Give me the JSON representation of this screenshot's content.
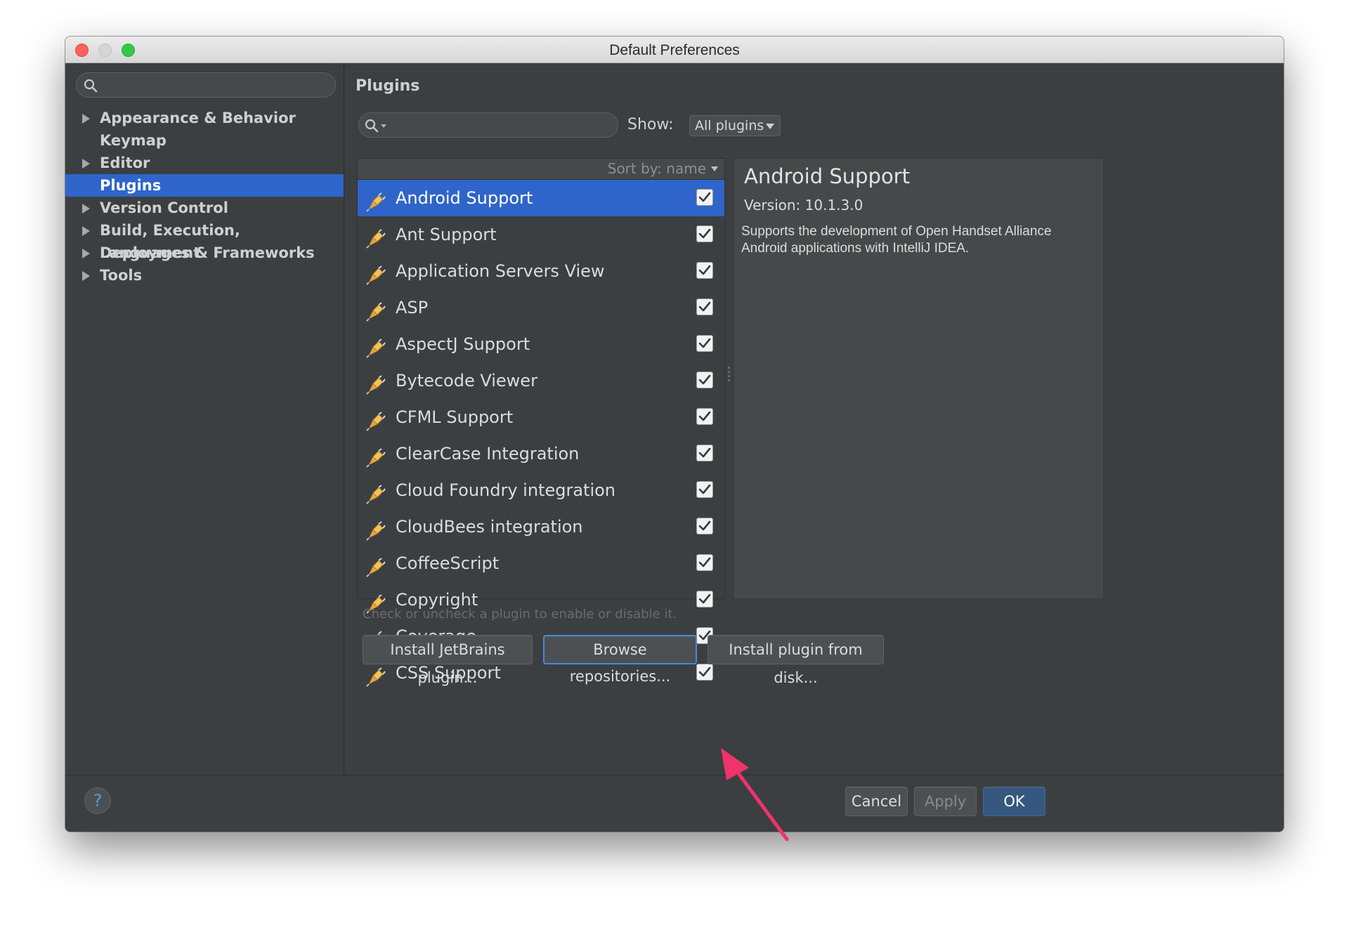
{
  "window": {
    "title": "Default Preferences"
  },
  "sidebar": {
    "search": {
      "placeholder": "",
      "icon": "search-icon"
    },
    "items": [
      {
        "label": "Appearance & Behavior",
        "expandable": true
      },
      {
        "label": "Keymap",
        "expandable": false
      },
      {
        "label": "Editor",
        "expandable": true
      },
      {
        "label": "Plugins",
        "expandable": false,
        "selected": true
      },
      {
        "label": "Version Control",
        "expandable": true
      },
      {
        "label": "Build, Execution, Deployment",
        "expandable": true
      },
      {
        "label": "Languages & Frameworks",
        "expandable": true
      },
      {
        "label": "Tools",
        "expandable": true
      }
    ]
  },
  "plugins": {
    "title": "Plugins",
    "search": {
      "placeholder": ""
    },
    "show_label": "Show:",
    "show_value": "All plugins",
    "sort_label": "Sort by: name",
    "items": [
      {
        "name": "Android Support",
        "enabled": true,
        "selected": true
      },
      {
        "name": "Ant Support",
        "enabled": true
      },
      {
        "name": "Application Servers View",
        "enabled": true
      },
      {
        "name": "ASP",
        "enabled": true
      },
      {
        "name": "AspectJ Support",
        "enabled": true
      },
      {
        "name": "Bytecode Viewer",
        "enabled": true
      },
      {
        "name": "CFML Support",
        "enabled": true
      },
      {
        "name": "ClearCase Integration",
        "enabled": true
      },
      {
        "name": "Cloud Foundry integration",
        "enabled": true
      },
      {
        "name": "CloudBees integration",
        "enabled": true
      },
      {
        "name": "CoffeeScript",
        "enabled": true
      },
      {
        "name": "Copyright",
        "enabled": true
      },
      {
        "name": "Coverage",
        "enabled": true
      },
      {
        "name": "CSS Support",
        "enabled": true
      }
    ],
    "hint": "Check or uncheck a plugin to enable or disable it.",
    "buttons": {
      "install_jetbrains": "Install JetBrains plugin...",
      "browse": "Browse repositories...",
      "install_disk": "Install plugin from disk..."
    }
  },
  "detail": {
    "title": "Android Support",
    "version": "Version: 10.1.3.0",
    "description": "Supports the development of Open Handset Alliance Android applications with IntelliJ IDEA."
  },
  "footer": {
    "help": "?",
    "cancel": "Cancel",
    "apply": "Apply",
    "ok": "OK"
  },
  "colors": {
    "selection": "#2f65ca",
    "annotation_arrow": "#f0336b",
    "default_button": "#365880"
  }
}
